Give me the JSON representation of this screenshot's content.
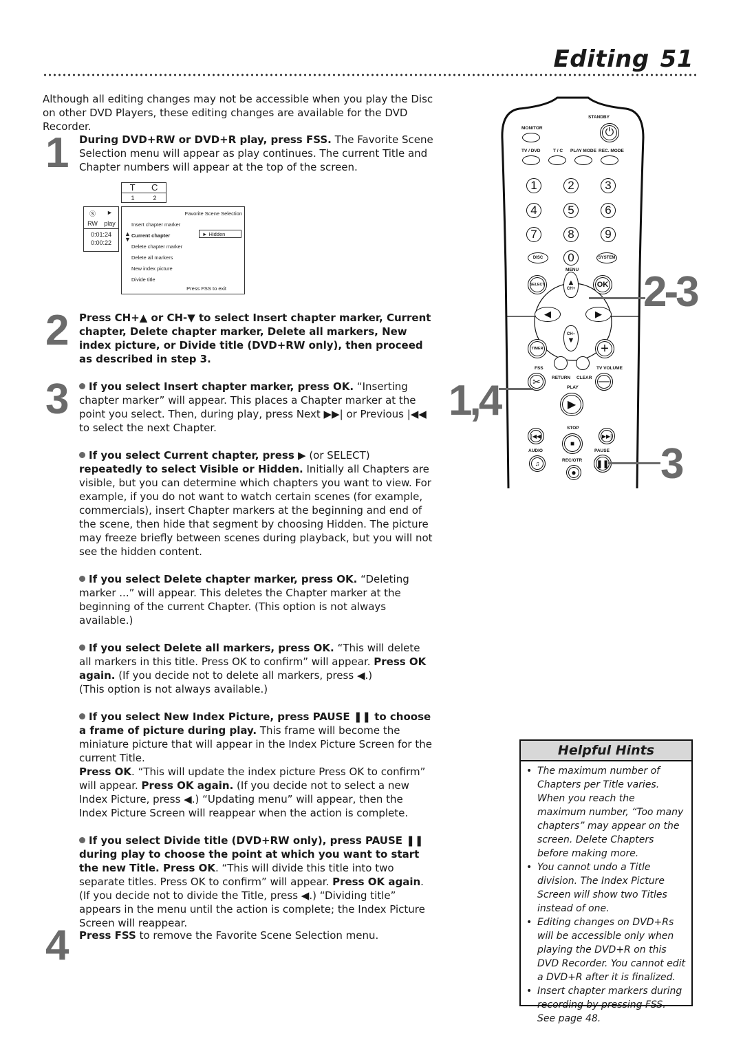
{
  "header": {
    "title": "Editing",
    "page_number": "51"
  },
  "intro": "Although all editing changes may not be accessible when you play the Disc on other DVD Players, these editing changes are available for the DVD Recorder.",
  "steps": [
    {
      "number": "1",
      "bold": "During DVD+RW or DVD+R play, press FSS.",
      "text": " The Favorite Scene Selection menu will appear as play continues. The current Title and Chapter numbers will appear at the top of the screen."
    },
    {
      "number": "2",
      "bold": "Press CH+▲ or CH-▼ to select Insert chapter marker, Current chapter, Delete chapter marker, Delete all markers, New index picture, or Divide title (DVD+RW only), then proceed as described in step 3.",
      "text": ""
    },
    {
      "number": "3",
      "bullets": [
        {
          "parts": [
            {
              "b": "If you select Insert chapter marker, press OK."
            },
            {
              "t": " “Inserting chapter marker” will appear.  This places a Chapter marker at the point you select.  Then, during play, press Next ▶▶| or Previous |◀◀ to select the next Chapter."
            }
          ]
        },
        {
          "parts": [
            {
              "b": "If you select Current chapter, press ▶"
            },
            {
              "t": " (or SELECT) "
            },
            {
              "b": "repeatedly to select Visible or Hidden."
            },
            {
              "t": " Initially all Chapters are visible, but you can determine which chapters you want to view. For example, if you do not want to watch certain scenes (for example, commercials), insert Chapter markers at the beginning and end of the scene, then hide that segment by choosing Hidden. The picture may freeze briefly between scenes during playback, but you will not see the hidden content."
            }
          ]
        },
        {
          "parts": [
            {
              "b": "If you select Delete chapter marker, press OK."
            },
            {
              "t": " “Deleting marker ...” will appear. This deletes the Chapter marker at the beginning of the current Chapter. (This option is not always available.)"
            }
          ]
        },
        {
          "parts": [
            {
              "b": "If you select Delete all markers, press OK."
            },
            {
              "t": " “This will delete all markers in this title. Press OK to confirm” will appear. "
            },
            {
              "b": "Press OK again."
            },
            {
              "t": " (If you decide not to delete all markers, press ◀.)"
            },
            {
              "br": true
            },
            {
              "t": "(This option is not always available.)"
            }
          ]
        },
        {
          "parts": [
            {
              "b": "If you select New Index Picture, press PAUSE ❚❚ to choose a frame of picture during play."
            },
            {
              "t": " This frame will become the miniature picture that will appear in the Index Picture Screen for the current Title."
            },
            {
              "br": true
            },
            {
              "b": "Press OK"
            },
            {
              "t": ". “This will update the index picture Press OK to confirm” will appear. "
            },
            {
              "b": "Press OK again."
            },
            {
              "t": " (If you decide not to select a new Index Picture, press ◀.) “Updating menu” will appear, then the Index Picture Screen will reappear when the action is complete."
            }
          ]
        },
        {
          "parts": [
            {
              "b": "If you select Divide title (DVD+RW only), press PAUSE ❚❚ during play to choose the point at which you want to start the new Title. Press OK"
            },
            {
              "t": ". “This will divide this title into two separate titles. Press OK to confirm” will appear. "
            },
            {
              "b": "Press OK again"
            },
            {
              "t": ". (If you decide not to divide the Title, press ◀.) “Dividing title” appears in the menu until the action is complete; the Index Picture Screen will reappear."
            }
          ]
        }
      ]
    },
    {
      "number": "4",
      "bold": "Press FSS",
      "text": " to remove the Favorite Scene Selection menu."
    }
  ],
  "osd": {
    "tc_labels": [
      "T",
      "C"
    ],
    "tc_values": [
      "1",
      "2"
    ],
    "disc_type": "RW",
    "play_state": "play",
    "time_total": "0:01:24",
    "time_chapter": "0:00:22",
    "menu_title": "Favorite Scene Selection",
    "items": [
      "Insert chapter marker",
      "Current chapter",
      "Delete chapter marker",
      "Delete all markers",
      "New index picture",
      "Divide title"
    ],
    "selected_index": 1,
    "current_value": "Hidden",
    "footer": "Press FSS to exit"
  },
  "remote": {
    "labels": {
      "standby": "STANDBY",
      "monitor": "MONITOR",
      "tv_dvd": "TV / DVD",
      "tc": "T / C",
      "play_mode": "PLAY MODE",
      "rec_mode": "REC. MODE",
      "disc": "DISC",
      "system": "SYSTEM",
      "menu": "MENU",
      "select": "SELECT",
      "ok": "OK",
      "ch_plus": "CH+",
      "ch_minus": "CH−",
      "timer": "TIMER",
      "fss": "FSS",
      "return": "RETURN",
      "clear": "CLEAR",
      "tv_volume": "TV VOLUME",
      "play": "PLAY",
      "stop": "STOP",
      "audio": "AUDIO",
      "pause": "PAUSE",
      "rec_otr": "REC/OTR"
    },
    "digits": [
      "1",
      "2",
      "3",
      "4",
      "5",
      "6",
      "7",
      "8",
      "9",
      "0"
    ],
    "callouts": {
      "nav": "2-3",
      "fss": "1,4",
      "pause": "3"
    }
  },
  "hints": {
    "title": "Helpful Hints",
    "items": [
      "The maximum number of Chapters per Title varies. When you reach the maximum number, “Too many chapters” may appear on the screen. Delete Chapters before making more.",
      "You cannot undo a Title division. The Index Picture Screen will show two Titles instead of one.",
      "Editing changes on DVD+Rs will be accessible only when playing the DVD+R on this DVD Recorder. You cannot edit a DVD+R after it is finalized.",
      "Insert chapter markers during recording by pressing FSS. See page 48."
    ]
  },
  "colors": {
    "step_number": "#6b6b6b",
    "hint_header_bg": "#d8d8d8",
    "text": "#1a1a1a"
  }
}
